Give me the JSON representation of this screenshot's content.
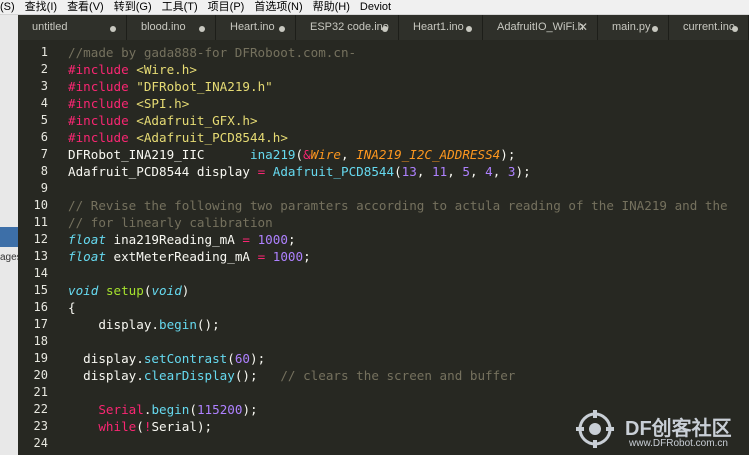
{
  "menubar": {
    "items": [
      "(S)",
      "查找(I)",
      "查看(V)",
      "转到(G)",
      "工具(T)",
      "项目(P)",
      "首选项(N)",
      "帮助(H)",
      "Deviot"
    ]
  },
  "sidebar": {
    "label": "ages"
  },
  "tabs": [
    {
      "label": "untitled",
      "state": "modified"
    },
    {
      "label": "blood.ino",
      "state": "modified"
    },
    {
      "label": "Heart.ino",
      "state": "modified"
    },
    {
      "label": "ESP32 code.ino",
      "state": "modified"
    },
    {
      "label": "Heart1.ino",
      "state": "modified"
    },
    {
      "label": "AdafruitIO_WiFi.h",
      "state": "close"
    },
    {
      "label": "main.py",
      "state": "modified"
    },
    {
      "label": "current.ino",
      "state": "modified"
    }
  ],
  "code": {
    "l1": {
      "n": "1",
      "t": [
        "//made by gada888-for DFRoboot.com.cn-"
      ]
    },
    "l2": {
      "n": "2",
      "t": [
        "#include",
        " ",
        "<Wire.h>"
      ]
    },
    "l3": {
      "n": "3",
      "t": [
        "#include",
        " ",
        "\"DFRobot_INA219.h\""
      ]
    },
    "l4": {
      "n": "4",
      "t": [
        "#include",
        " ",
        "<SPI.h>"
      ]
    },
    "l5": {
      "n": "5",
      "t": [
        "#include",
        " ",
        "<Adafruit_GFX.h>"
      ]
    },
    "l6": {
      "n": "6",
      "t": [
        "#include",
        " ",
        "<Adafruit_PCD8544.h>"
      ]
    },
    "l7": {
      "n": "7",
      "t": [
        "DFRobot_INA219_IIC      ",
        "ina219",
        "(",
        "&",
        "Wire",
        ", ",
        "INA219_I2C_ADDRESS4",
        ");"
      ]
    },
    "l8": {
      "n": "8",
      "t": [
        "Adafruit_PCD8544 display ",
        "=",
        " ",
        "Adafruit_PCD8544",
        "(",
        "13",
        ", ",
        "11",
        ", ",
        "5",
        ", ",
        "4",
        ", ",
        "3",
        ");"
      ]
    },
    "l9": {
      "n": "9",
      "t": []
    },
    "l10": {
      "n": "10",
      "t": [
        "// Revise the following two paramters according to actula reading of the INA219 and the"
      ]
    },
    "l11": {
      "n": "11",
      "t": [
        "// for linearly calibration"
      ]
    },
    "l12": {
      "n": "12",
      "t": [
        "float",
        " ina219Reading_mA ",
        "=",
        " ",
        "1000",
        ";"
      ]
    },
    "l13": {
      "n": "13",
      "t": [
        "float",
        " extMeterReading_mA ",
        "=",
        " ",
        "1000",
        ";"
      ]
    },
    "l14": {
      "n": "14",
      "t": []
    },
    "l15": {
      "n": "15",
      "t": [
        "void",
        " ",
        "setup",
        "(",
        "void",
        ")"
      ]
    },
    "l16": {
      "n": "16",
      "t": [
        "{"
      ]
    },
    "l17": {
      "n": "17",
      "t": [
        "    display.",
        "begin",
        "();"
      ]
    },
    "l18": {
      "n": "18",
      "t": []
    },
    "l19": {
      "n": "19",
      "t": [
        "  display.",
        "setContrast",
        "(",
        "60",
        ");"
      ]
    },
    "l20": {
      "n": "20",
      "t": [
        "  display.",
        "clearDisplay",
        "();",
        "   ",
        "// clears the screen and buffer"
      ]
    },
    "l21": {
      "n": "21",
      "t": []
    },
    "l22": {
      "n": "22",
      "t": [
        "    ",
        "Serial",
        ".",
        "begin",
        "(",
        "115200",
        ");"
      ]
    },
    "l23": {
      "n": "23",
      "t": [
        "    ",
        "while",
        "(",
        "!",
        "Serial",
        ");"
      ]
    },
    "l24": {
      "n": "24",
      "t": []
    }
  },
  "watermark": {
    "title": "DF创客社区",
    "url": "www.DFRobot.com.cn"
  },
  "colors": {
    "background": "#272822",
    "comment": "#75715e",
    "keyword": "#f92672",
    "string": "#e6db74",
    "function": "#66d9ef",
    "number": "#ae81ff",
    "constant": "#fd971f"
  }
}
